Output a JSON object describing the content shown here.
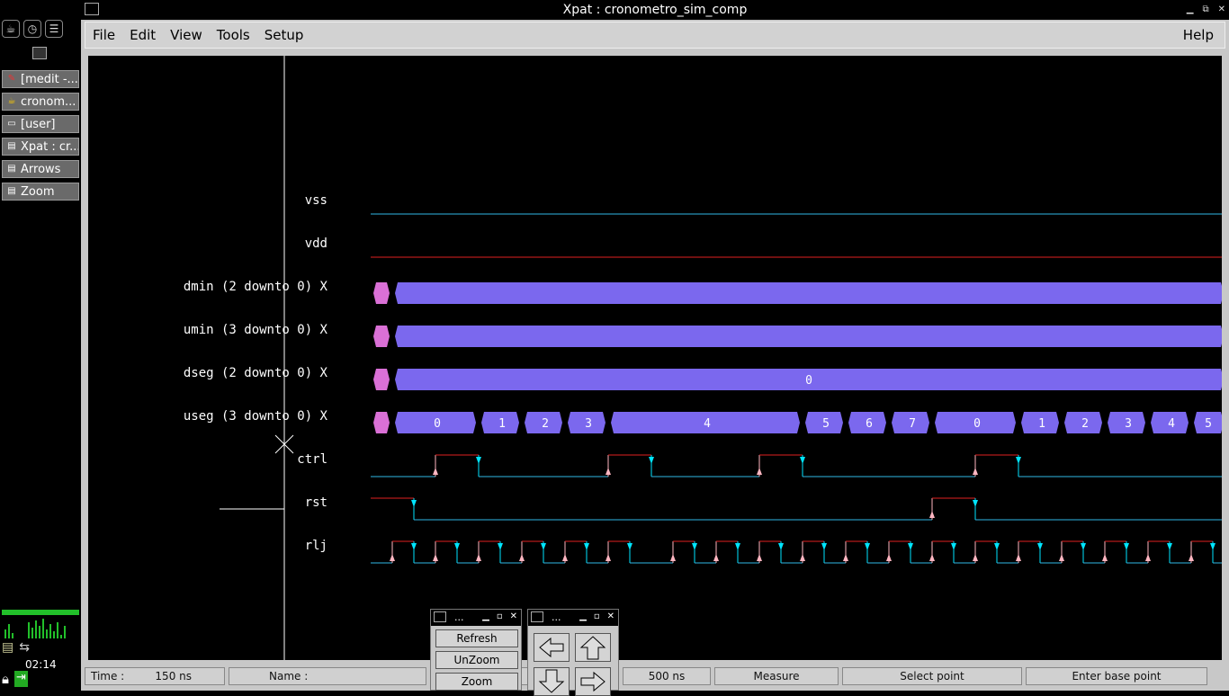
{
  "window": {
    "title": "Xpat : cronometro_sim_comp"
  },
  "menu": {
    "file": "File",
    "edit": "Edit",
    "view": "View",
    "tools": "Tools",
    "setup": "Setup",
    "help": "Help"
  },
  "taskbar": {
    "tasks": [
      {
        "label": "[medit -...",
        "icon": "edit-icon"
      },
      {
        "label": "cronom...",
        "icon": "app-icon"
      },
      {
        "label": "[user]",
        "icon": "folder-icon"
      },
      {
        "label": "Xpat : cr...",
        "icon": "window-icon"
      },
      {
        "label": "Arrows",
        "icon": "window-icon"
      },
      {
        "label": "Zoom",
        "icon": "window-icon"
      }
    ],
    "clock": "02:14"
  },
  "signals": [
    {
      "name": "vss",
      "type": "line",
      "color": "#2fb7e6"
    },
    {
      "name": "vdd",
      "type": "line",
      "color": "#e02020"
    },
    {
      "name": "dmin (2 downto 0) X",
      "type": "bus",
      "segments": [
        {
          "label": "",
          "from": 0,
          "to": 1
        },
        {
          "label": "",
          "from": 1,
          "to": 40
        }
      ]
    },
    {
      "name": "umin (3 downto 0) X",
      "type": "bus",
      "segments": [
        {
          "label": "",
          "from": 0,
          "to": 1
        },
        {
          "label": "",
          "from": 1,
          "to": 40
        }
      ]
    },
    {
      "name": "dseg (2 downto 0) X",
      "type": "bus",
      "segments": [
        {
          "label": "",
          "from": 0,
          "to": 1
        },
        {
          "label": "0",
          "from": 1,
          "to": 40
        }
      ]
    },
    {
      "name": "useg (3 downto 0) X",
      "type": "bus",
      "segments": [
        {
          "label": "",
          "from": 0,
          "to": 1
        },
        {
          "label": "0",
          "from": 1,
          "to": 5
        },
        {
          "label": "1",
          "from": 5,
          "to": 7
        },
        {
          "label": "2",
          "from": 7,
          "to": 9
        },
        {
          "label": "3",
          "from": 9,
          "to": 11
        },
        {
          "label": "4",
          "from": 11,
          "to": 20
        },
        {
          "label": "5",
          "from": 20,
          "to": 22
        },
        {
          "label": "6",
          "from": 22,
          "to": 24
        },
        {
          "label": "7",
          "from": 24,
          "to": 26
        },
        {
          "label": "0",
          "from": 26,
          "to": 30
        },
        {
          "label": "1",
          "from": 30,
          "to": 32
        },
        {
          "label": "2",
          "from": 32,
          "to": 34
        },
        {
          "label": "3",
          "from": 34,
          "to": 36
        },
        {
          "label": "4",
          "from": 36,
          "to": 38
        },
        {
          "label": "5",
          "from": 38,
          "to": 40
        }
      ]
    },
    {
      "name": "ctrl",
      "type": "digital",
      "initial": 0,
      "edges": [
        3,
        5,
        11,
        13,
        18,
        20,
        28,
        30
      ]
    },
    {
      "name": "rst",
      "type": "digital",
      "initial": 1,
      "edges": [
        2,
        26,
        28
      ]
    },
    {
      "name": "rlj",
      "type": "digital",
      "initial": 0,
      "edges": [
        1,
        2,
        3,
        4,
        5,
        6,
        7,
        8,
        9,
        10,
        11,
        12,
        14,
        15,
        16,
        17,
        18,
        19,
        20,
        21,
        22,
        23,
        24,
        25,
        26,
        27,
        28,
        29,
        30,
        31,
        32,
        33,
        34,
        35,
        36,
        37,
        38,
        39
      ]
    }
  ],
  "colors": {
    "bus_fill": "#7b68ee",
    "bus_unknown": "#da70d6",
    "high": "#e02020",
    "low": "#2fb7e6",
    "rise_arrow": "#ffb6c1",
    "fall_arrow": "#00e5ff",
    "cursor": "#ffffff"
  },
  "status": {
    "time_label": "Time :",
    "time_value": "150 ns",
    "name_label": "Name :",
    "step_value": "500 ns",
    "measure": "Measure",
    "select_point": "Select point",
    "enter_base_point": "Enter base point"
  },
  "zoom_panel": {
    "title": "...",
    "refresh": "Refresh",
    "unzoom": "UnZoom",
    "zoom": "Zoom"
  },
  "arrows_panel": {
    "title": "..."
  }
}
